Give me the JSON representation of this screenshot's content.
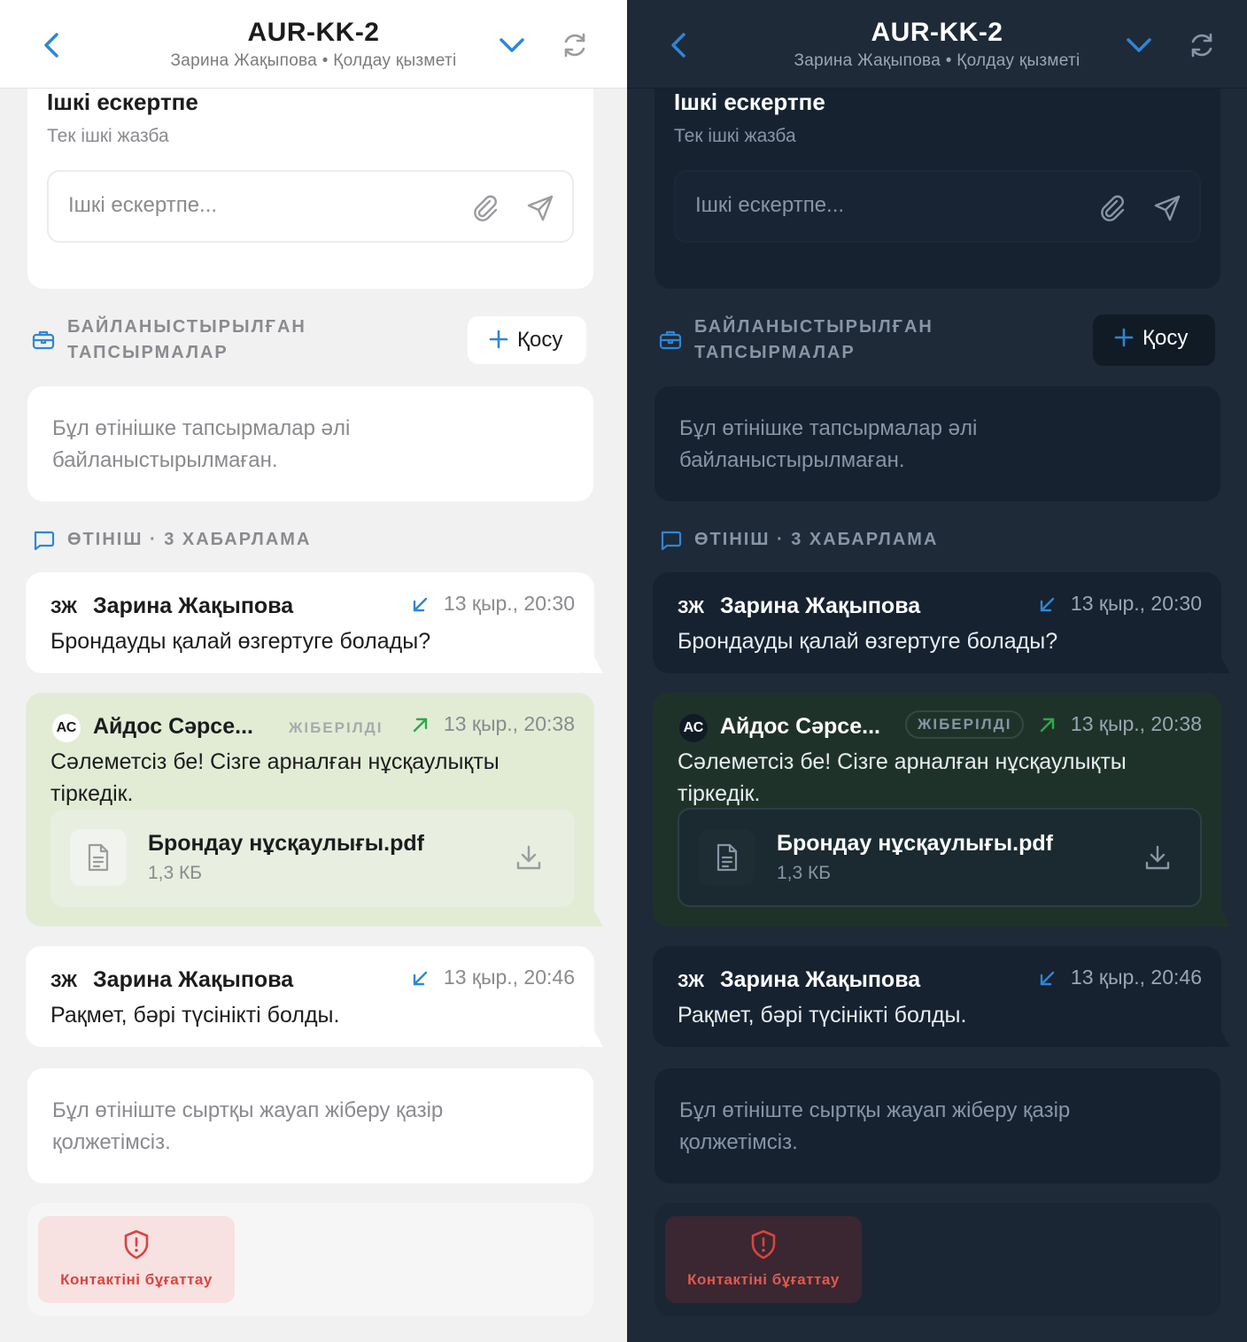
{
  "colors": {
    "accent": "#2f86d6",
    "danger": "#d9443f",
    "outgoing_light": "#e2ecd5",
    "outgoing_dark": "#1f3229"
  },
  "header": {
    "title": "AUR-KK-2",
    "subtitle": "Зарина Жақыпова • Қолдау қызметі",
    "icons": [
      "chevron-left-icon",
      "chevron-down-icon",
      "refresh-icon"
    ]
  },
  "note": {
    "title": "Ішкі ескертпе",
    "subtitle": "Тек ішкі жазба",
    "placeholder": "Ішкі ескертпе...",
    "icons": [
      "paperclip-icon",
      "send-icon"
    ]
  },
  "tasks": {
    "section_line1": "БАЙЛАНЫСТЫРЫЛҒАН",
    "section_line2": "ТАПСЫРМАЛАР",
    "add_label": "Қосу",
    "empty_text": "Бұл өтінішке тапсырмалар әлі байланыстырылмаған."
  },
  "thread": {
    "section_label": "ӨТІНІШ · 3 ХАБАРЛАМА",
    "messages": [
      {
        "initials": "ЗЖ",
        "name": "Зарина Жақыпова",
        "direction": "incoming",
        "time": "13 қыр., 20:30",
        "text": "Брондауды қалай өзгертуге болады?"
      },
      {
        "initials": "АС",
        "name": "Айдос Сәрсе...",
        "status": "ЖІБЕРІЛДІ",
        "direction": "outgoing",
        "time": "13 қыр., 20:38",
        "text": "Сәлеметсіз бе! Сізге арналған нұсқаулықты тіркедік.",
        "attachment": {
          "name": "Брондау нұсқаулығы.pdf",
          "size": "1,3 КБ"
        }
      },
      {
        "initials": "ЗЖ",
        "name": "Зарина Жақыпова",
        "direction": "incoming",
        "time": "13 қыр., 20:46",
        "text": "Рақмет, бәрі түсінікті болды."
      }
    ]
  },
  "reply_closed_text": "Бұл өтініште сыртқы жауап жіберу қазір қолжетімсіз.",
  "block_contact_label": "Контактіні бұғаттау"
}
